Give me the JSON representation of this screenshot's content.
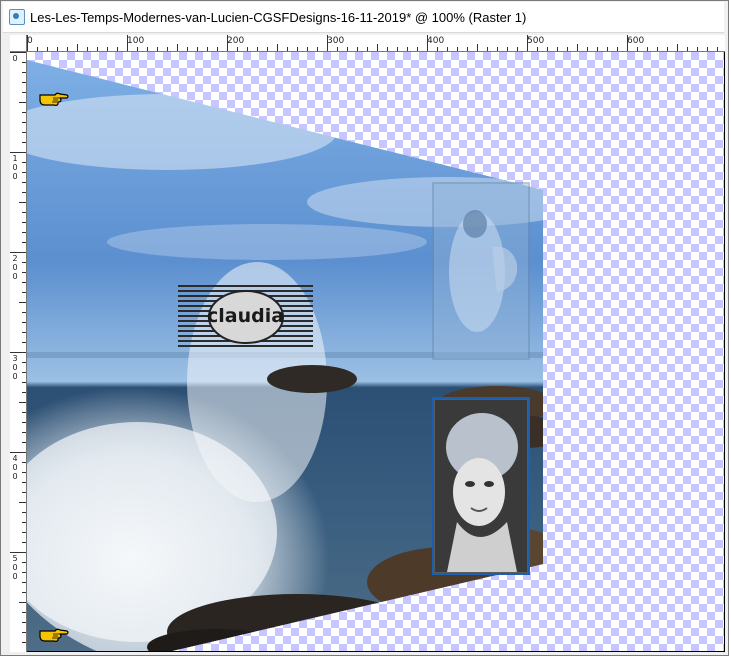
{
  "window": {
    "title": "Les-Les-Temps-Modernes-van-Lucien-CGSFDesigns-16-11-2019* @ 100% (Raster 1)"
  },
  "rulers": {
    "horizontal_labels": [
      "0",
      "100",
      "200",
      "300",
      "400",
      "500",
      "600"
    ],
    "vertical_labels": [
      "0",
      "100",
      "200",
      "300",
      "400",
      "500"
    ]
  },
  "canvas": {
    "watermark_text": "claudia",
    "checker_color": "#c7c6ff",
    "sky_color": "#5b8fcf",
    "sea_color": "#2c4f74",
    "frame_color": "#1b5fb0"
  },
  "icons": {
    "top_pointer": "pointing-hand-icon",
    "bottom_pointer": "pointing-hand-icon"
  }
}
